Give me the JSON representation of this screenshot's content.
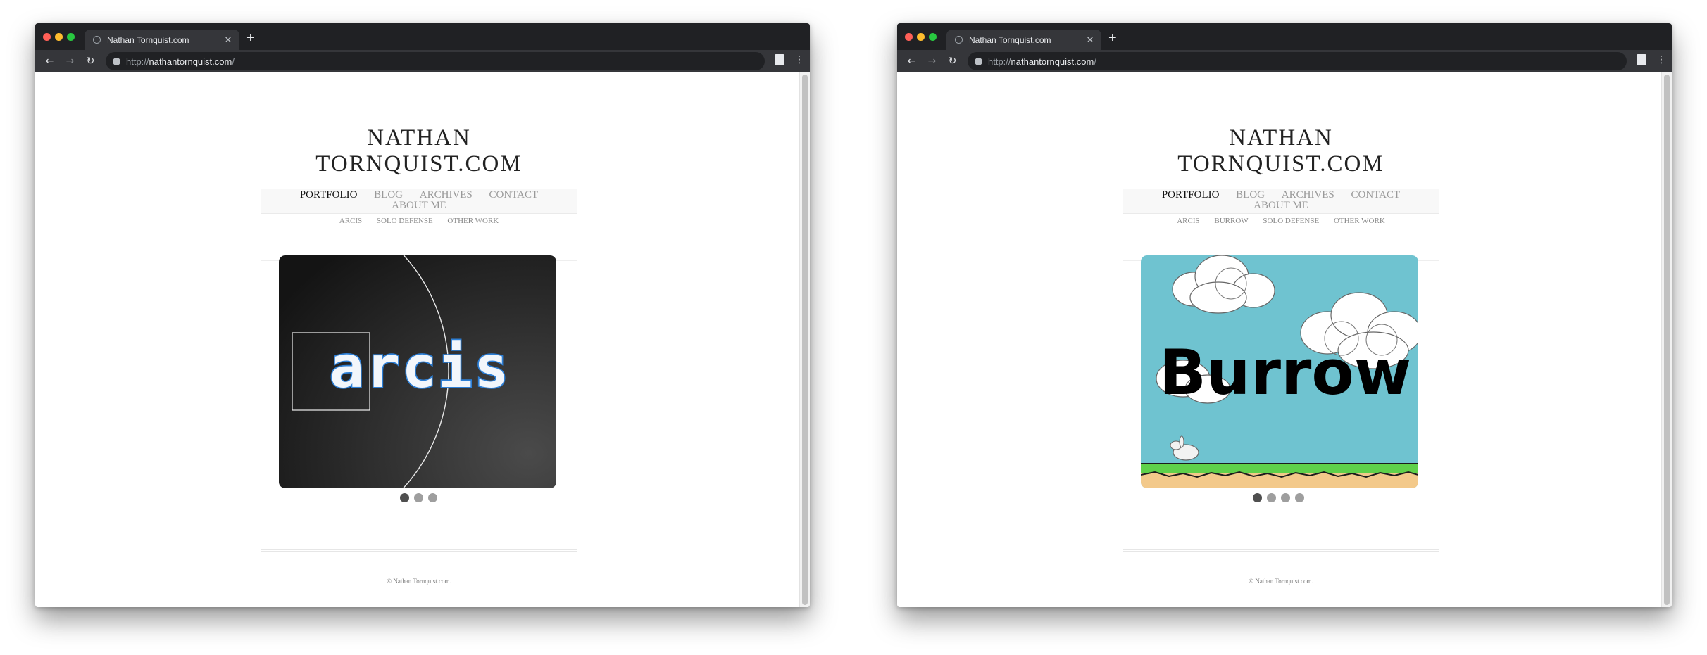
{
  "windows": [
    {
      "tab_title": "Nathan Tornquist.com",
      "url_protocol": "http://",
      "url_host": "nathantornquist.com",
      "url_rest": "/",
      "site": {
        "title": "NATHAN  TORNQUIST.COM",
        "menu": [
          "PORTFOLIO",
          "BLOG",
          "ARCHIVES",
          "CONTACT"
        ],
        "menu_second_line": "ABOUT ME",
        "submenu": [
          "ARCIS",
          "SOLO DEFENSE",
          "OTHER WORK"
        ],
        "slide_logo": "arcis",
        "slides_count": 3,
        "footer": "© Nathan Tornquist.com."
      }
    },
    {
      "tab_title": "Nathan Tornquist.com",
      "url_protocol": "http://",
      "url_host": "nathantornquist.com",
      "url_rest": "/",
      "site": {
        "title": "NATHAN  TORNQUIST.COM",
        "menu": [
          "PORTFOLIO",
          "BLOG",
          "ARCHIVES",
          "CONTACT"
        ],
        "menu_second_line": "ABOUT ME",
        "submenu": [
          "ARCIS",
          "BURROW",
          "SOLO DEFENSE",
          "OTHER WORK"
        ],
        "slide_logo": "Burrow",
        "slides_count": 4,
        "footer": "© Nathan Tornquist.com."
      }
    }
  ],
  "icons": {
    "back": "arrow-left-icon",
    "forward": "arrow-right-icon",
    "reload": "reload-icon",
    "info": "globe-icon",
    "extension": "extension-icon",
    "menu": "more-vert-icon",
    "close_tab": "close-icon",
    "new_tab": "plus-icon"
  },
  "colors": {
    "chrome_dark": "#202124",
    "chrome_toolbar": "#35363a",
    "sky": "#6fc3d0",
    "grass": "#5fd14a",
    "dirt": "#f3c98a",
    "arcis_blue": "#2d7fd6"
  }
}
